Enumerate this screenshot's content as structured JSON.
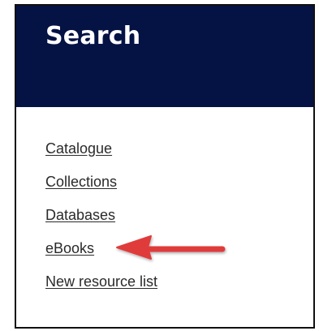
{
  "panel": {
    "title": "Search",
    "header_color": "#051244"
  },
  "links": [
    {
      "label": "Catalogue"
    },
    {
      "label": "Collections"
    },
    {
      "label": "Databases"
    },
    {
      "label": "eBooks"
    },
    {
      "label": "New resource list"
    }
  ],
  "annotation": {
    "icon": "arrow-left-icon",
    "color": "#e03b3b",
    "points_to": "eBooks"
  }
}
